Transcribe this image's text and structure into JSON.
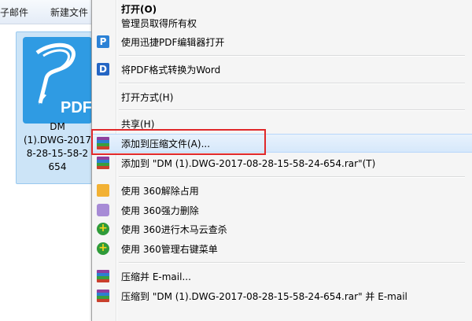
{
  "explorer": {
    "toolbar": {
      "mail_label": "子邮件",
      "new_folder_label": "新建文件"
    },
    "file": {
      "name": "DM\n(1).DWG-2017\n8-28-15-58-2\n654",
      "icon_text": "PDF"
    }
  },
  "context_menu": {
    "items": [
      {
        "id": "open",
        "label": "打开(O)"
      },
      {
        "id": "take-ownership",
        "label": "管理员取得所有权"
      },
      {
        "id": "open-with-pdf-editor",
        "label": "使用迅捷PDF编辑器打开",
        "icon": "pdf-editor-icon"
      },
      {
        "id": "pdf-to-word",
        "label": "将PDF格式转换为Word",
        "icon": "pdf-converter-icon"
      },
      {
        "id": "open-with",
        "label": "打开方式(H)"
      },
      {
        "id": "share",
        "label": "共享(H)"
      },
      {
        "id": "add-to-archive",
        "label": "添加到压缩文件(A)...",
        "icon": "winrar-icon"
      },
      {
        "id": "add-to-rar",
        "label": "添加到 \"DM (1).DWG-2017-08-28-15-58-24-654.rar\"(T)",
        "icon": "winrar-icon"
      },
      {
        "id": "360-unlock",
        "label": "使用 360解除占用",
        "icon": "360-unlock-icon"
      },
      {
        "id": "360-force-delete",
        "label": "使用 360强力删除",
        "icon": "360-delete-icon"
      },
      {
        "id": "360-trojan-scan",
        "label": "使用 360进行木马云查杀",
        "icon": "360-shield-icon"
      },
      {
        "id": "360-manage-menu",
        "label": "使用 360管理右键菜单",
        "icon": "360-shield-icon"
      },
      {
        "id": "compress-email",
        "label": "压缩并 E-mail...",
        "icon": "winrar-icon"
      },
      {
        "id": "compress-to-rar-email",
        "label": "压缩到 \"DM (1).DWG-2017-08-28-15-58-24-654.rar\" 并 E-mail",
        "icon": "winrar-icon"
      }
    ]
  },
  "colors": {
    "highlight_box": "#e0282a",
    "selection_bg": "#cce4f7",
    "menu_bg": "#f5f5f5"
  }
}
